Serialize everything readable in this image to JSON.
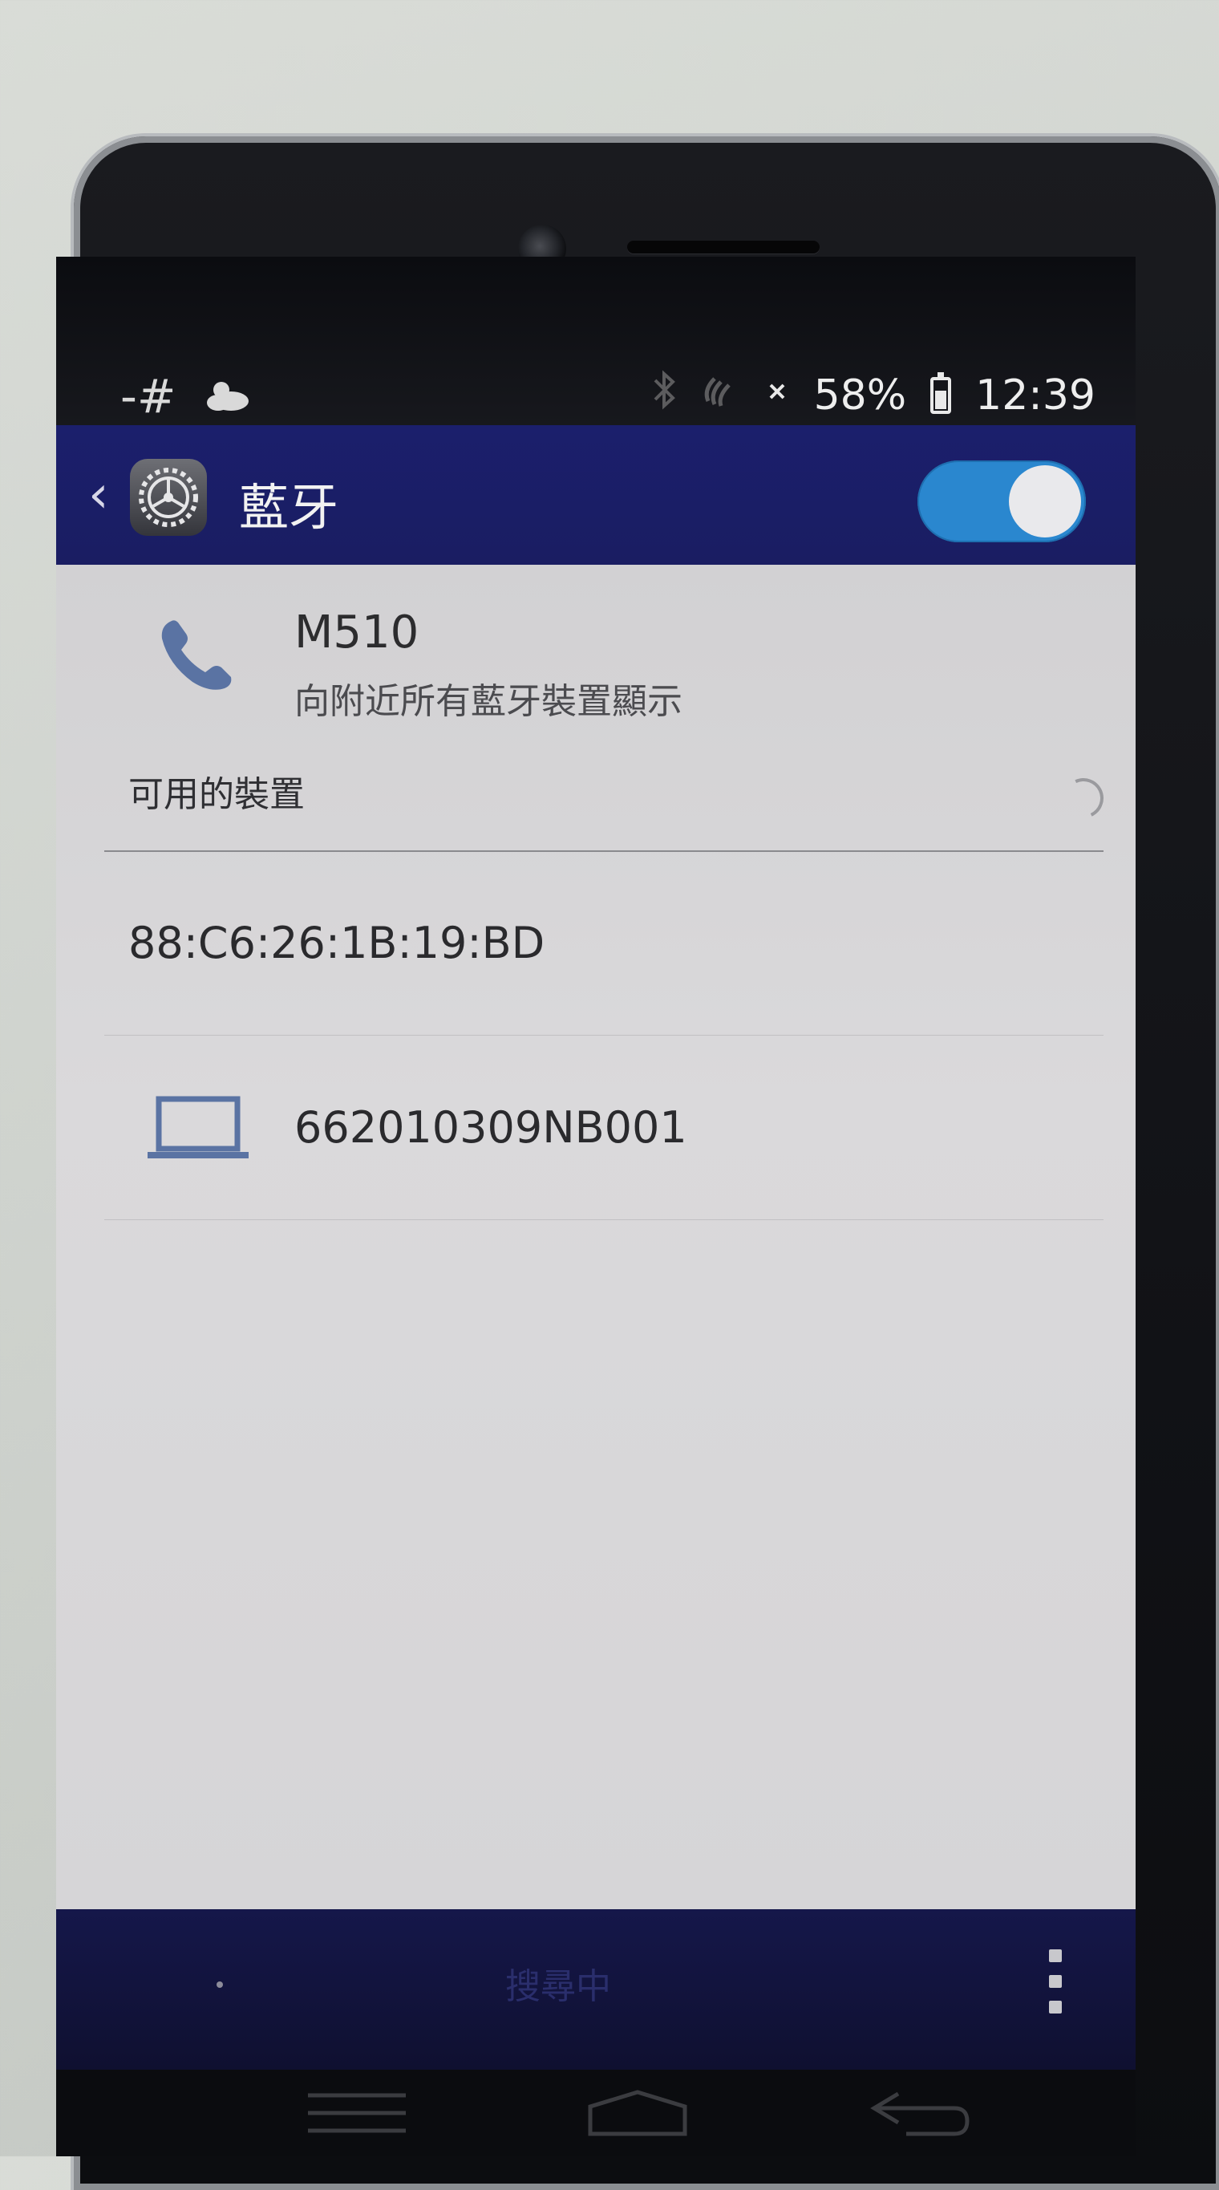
{
  "status_bar": {
    "left_icons": [
      "-#",
      "weather-cloud-icon"
    ],
    "battery_percent": "58%",
    "battery_level": 0.58,
    "time": "12:39",
    "notification_icons": [
      "bluetooth-icon",
      "nfc-icon",
      "signal-off-icon"
    ]
  },
  "app_bar": {
    "title": "藍牙",
    "bluetooth_enabled": true,
    "toggle_color": "#2a87cf"
  },
  "this_device": {
    "name": "M510",
    "visibility_text": "向附近所有藍牙裝置顯示"
  },
  "available_devices": {
    "header": "可用的裝置",
    "items": [
      {
        "label": "88:C6:26:1B:19:BD",
        "icon": ""
      },
      {
        "label": "662010309NB001",
        "icon": "laptop-icon"
      }
    ]
  },
  "bottom_bar": {
    "status_text": "搜尋中"
  },
  "colors": {
    "app_bar": "#1b1f6c",
    "content_bg": "#d6d5d7",
    "icon_blue": "#5a73a3"
  }
}
